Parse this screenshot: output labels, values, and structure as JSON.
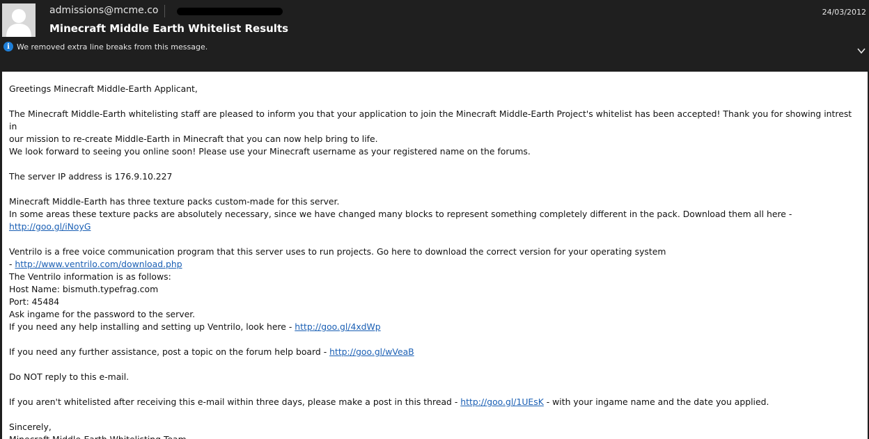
{
  "header": {
    "sender": "admissions@mcme.co",
    "date": "24/03/2012",
    "subject": "Minecraft Middle Earth Whitelist Results",
    "notice": "We removed extra line breaks from this message.",
    "icons": {
      "avatar": "person-icon",
      "info": "info-icon",
      "expand": "chevron-down-icon"
    }
  },
  "email": {
    "greeting": "Greetings Minecraft Middle-Earth Applicant,",
    "para1_line1": "The Minecraft Middle-Earth whitelisting staff are pleased to inform you that your application to join the Minecraft Middle-Earth Project's whitelist has been accepted! Thank you for showing intrest in",
    "para1_line2": "our mission to re-create Middle-Earth in Minecraft that you can now help bring to life.",
    "para1_line3": "We look forward to seeing you online soon! Please use your Minecraft username as your registered name on the forums.",
    "server_ip": "The server IP address is 176.9.10.227",
    "texture_line1": "Minecraft Middle-Earth has three texture packs custom-made for this server.",
    "texture_line2_prefix": "In some areas these texture packs are absolutely necessary, since we have changed many blocks to represent something completely different in the pack. Download them all here - ",
    "texture_link": "http://goo.gl/iNoyG",
    "ventrilo_line1": "Ventrilo is a free voice communication program that this server uses to run projects. Go here to download the correct version for your operating system",
    "ventrilo_dash": "- ",
    "ventrilo_link": "http://www.ventrilo.com/download.php",
    "ventrilo_info": "The Ventrilo information is as follows:",
    "ventrilo_host": "Host Name: bismuth.typefrag.com",
    "ventrilo_port": "Port: 45484",
    "ventrilo_password": "Ask ingame for the password to the server.",
    "ventrilo_help_prefix": "If you need any help installing and setting up Ventrilo, look here - ",
    "ventrilo_help_link": "http://goo.gl/4xdWp",
    "assist_prefix": "If you need any further assistance, post a topic on the forum help board - ",
    "assist_link": "http://goo.gl/wVeaB",
    "no_reply": "Do NOT reply to this e-mail.",
    "whitelist_prefix": "If you aren't whitelisted after receiving this e-mail within three days, please make a post in this thread - ",
    "whitelist_link": "http://goo.gl/1UEsK",
    "whitelist_suffix": " - with your ingame name and the date you applied.",
    "signoff": "Sincerely,",
    "team": "Minecraft Middle-Earth Whitelisting Team"
  },
  "colors": {
    "header_bg": "#1f1f1f",
    "link": "#1a5fb4",
    "info_blue": "#1f7fd8"
  }
}
